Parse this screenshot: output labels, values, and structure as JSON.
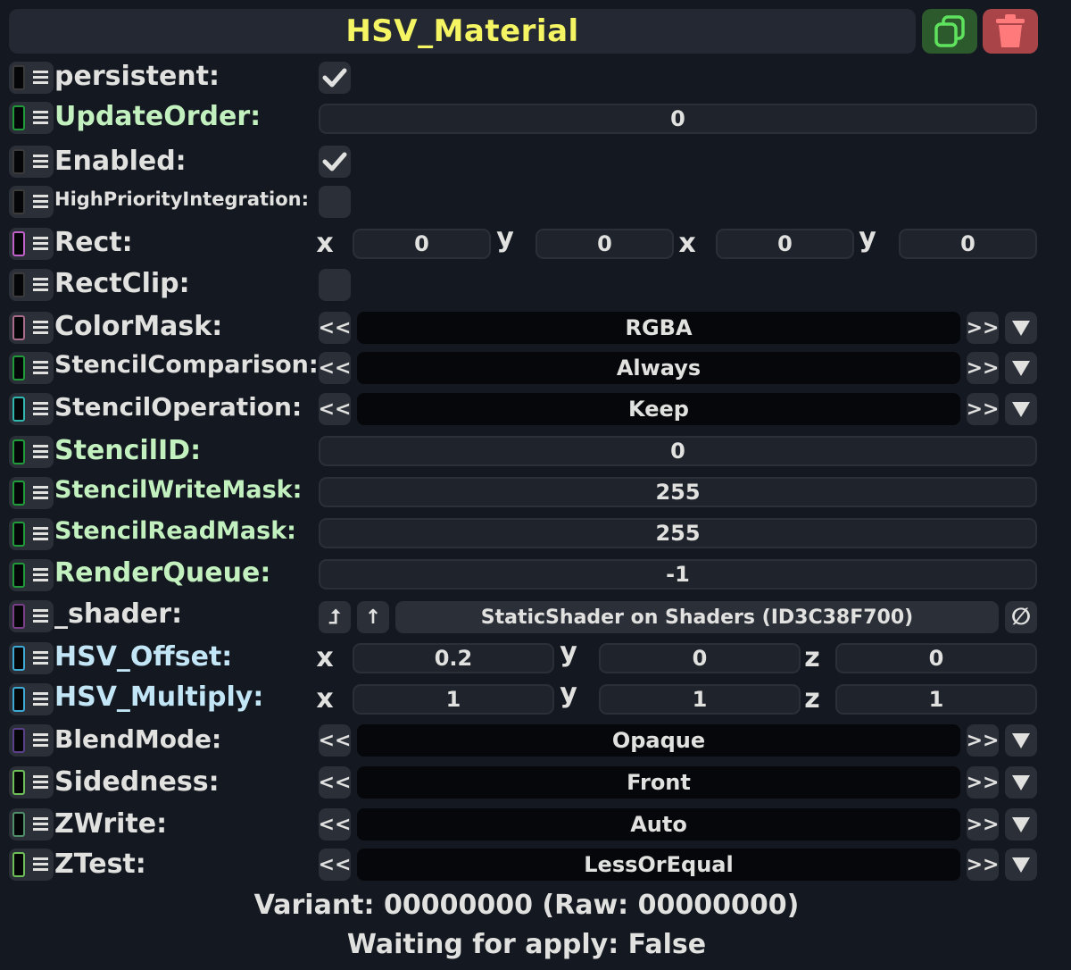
{
  "header": {
    "title": "HSV_Material"
  },
  "colors": {
    "title": "#f5f564",
    "duplicate_button": "#2d5a2d",
    "duplicate_icon": "#5fe35f",
    "delete_button": "#a94549",
    "delete_icon": "#ff7b7b",
    "label_green": "#c2f1bf",
    "label_teal": "#c0efe8",
    "label_cyan": "#c3e6f7"
  },
  "icons": {
    "duplicate": "duplicate-icon",
    "delete": "trash-icon",
    "drag": "drag-handle-icon",
    "check": "checkmark-icon",
    "dropdown": "triangle-down-icon",
    "clear": "null-icon"
  },
  "fields": {
    "persistent": {
      "label": "persistent:",
      "checked": true
    },
    "update_order": {
      "label": "UpdateOrder:",
      "value": "0"
    },
    "enabled": {
      "label": "Enabled:",
      "checked": true
    },
    "high_priority": {
      "label": "HighPriorityIntegration:",
      "checked": false
    },
    "rect": {
      "label": "Rect:",
      "axes": [
        "x",
        "y",
        "x",
        "y"
      ],
      "values": [
        "0",
        "0",
        "0",
        "0"
      ]
    },
    "rect_clip": {
      "label": "RectClip:",
      "checked": false
    },
    "color_mask": {
      "label": "ColorMask:",
      "value": "RGBA"
    },
    "stencil_comparison": {
      "label": "StencilComparison:",
      "value": "Always"
    },
    "stencil_operation": {
      "label": "StencilOperation:",
      "value": "Keep"
    },
    "stencil_id": {
      "label": "StencilID:",
      "value": "0"
    },
    "stencil_write_mask": {
      "label": "StencilWriteMask:",
      "value": "255"
    },
    "stencil_read_mask": {
      "label": "StencilReadMask:",
      "value": "255"
    },
    "render_queue": {
      "label": "RenderQueue:",
      "value": "-1"
    },
    "shader": {
      "label": "_shader:",
      "value": "StaticShader on Shaders (ID3C38F700)",
      "open_label": "⮥",
      "up_label": "↑",
      "clear_label": "∅"
    },
    "hsv_offset": {
      "label": "HSV_Offset:",
      "axes": [
        "x",
        "y",
        "z"
      ],
      "values": [
        "0.2",
        "0",
        "0"
      ]
    },
    "hsv_multiply": {
      "label": "HSV_Multiply:",
      "axes": [
        "x",
        "y",
        "z"
      ],
      "values": [
        "1",
        "1",
        "1"
      ]
    },
    "blend_mode": {
      "label": "BlendMode:",
      "value": "Opaque"
    },
    "sidedness": {
      "label": "Sidedness:",
      "value": "Front"
    },
    "zwrite": {
      "label": "ZWrite:",
      "value": "Auto"
    },
    "ztest": {
      "label": "ZTest:",
      "value": "LessOrEqual"
    }
  },
  "enum_buttons": {
    "prev": "<<",
    "next": ">>"
  },
  "footer": {
    "variant": "Variant: 00000000 (Raw: 00000000)",
    "waiting": "Waiting for apply: False"
  }
}
